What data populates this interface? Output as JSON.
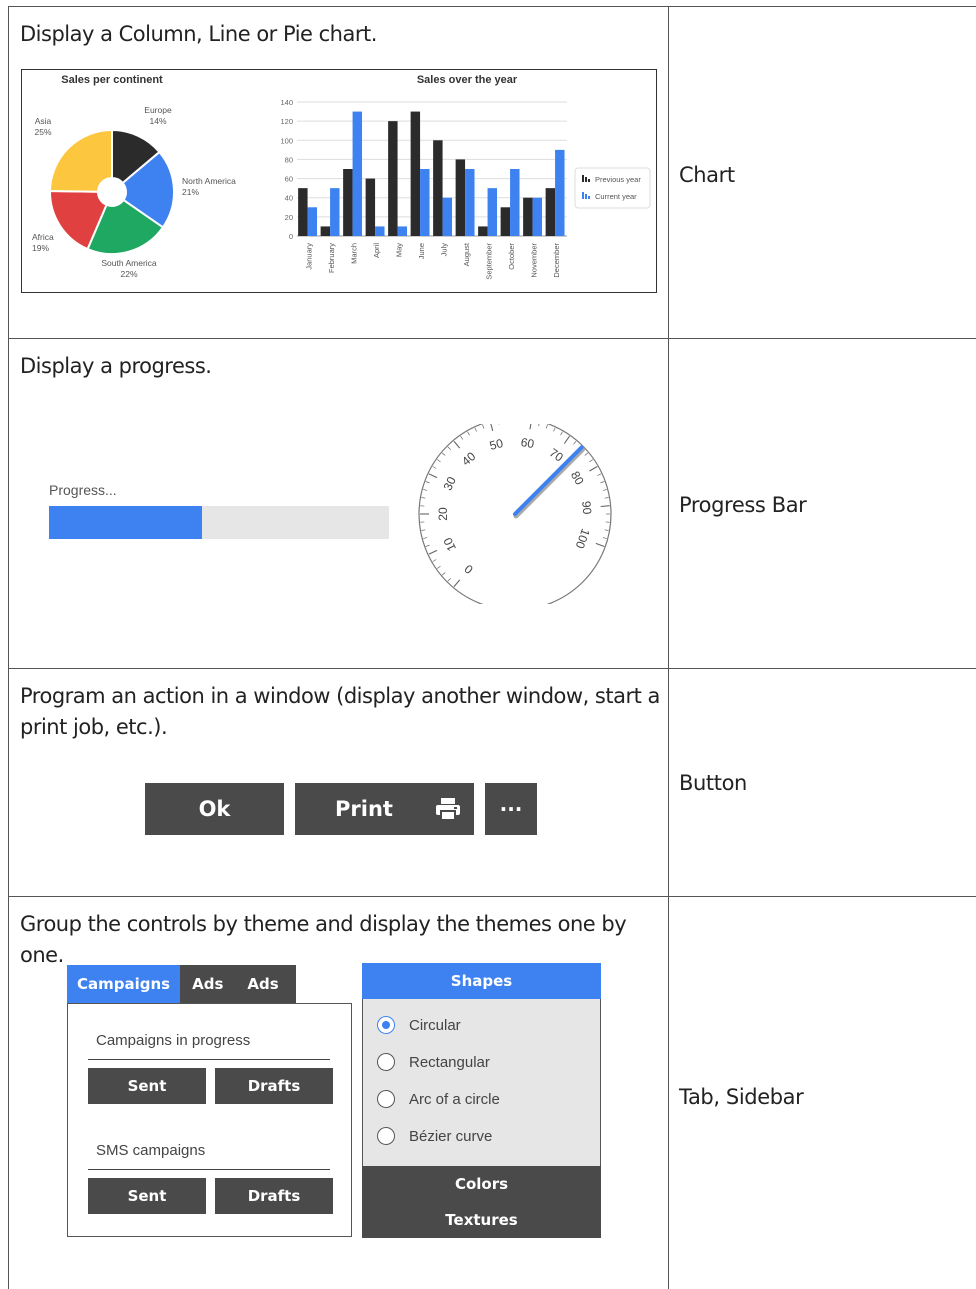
{
  "rows": [
    {
      "description": "Display a Column, Line or Pie chart.",
      "name": "Chart"
    },
    {
      "description": "Display a progress.",
      "name": "Progress Bar"
    },
    {
      "description": "Program an action in a window (display another window, start a print job, etc.).",
      "name": "Button"
    },
    {
      "description": "Group the controls by theme and display the themes one by one.",
      "name": "Tab, Sidebar"
    }
  ],
  "colors": {
    "blue": "#3d82f0",
    "dark": "#4a4a4a",
    "pie_black": "#2b2b2b",
    "pie_blue": "#3d82f0",
    "pie_green": "#1fa862",
    "pie_red": "#e04040",
    "pie_yellow": "#fcc63f"
  },
  "chart_data": [
    {
      "type": "pie",
      "title": "Sales per continent",
      "categories": [
        "Europe",
        "North America",
        "South America",
        "Africa",
        "Asia"
      ],
      "values": [
        14,
        21,
        22,
        19,
        25
      ],
      "value_labels": [
        "14%",
        "21%",
        "22%",
        "19%",
        "25%"
      ],
      "colors": [
        "#2b2b2b",
        "#3d82f0",
        "#1fa862",
        "#e04040",
        "#fcc63f"
      ],
      "donut": true
    },
    {
      "type": "bar",
      "title": "Sales over the year",
      "categories": [
        "January",
        "February",
        "March",
        "April",
        "May",
        "June",
        "July",
        "August",
        "September",
        "October",
        "November",
        "December"
      ],
      "series": [
        {
          "name": "Previous year",
          "color": "#2b2b2b",
          "values": [
            50,
            10,
            70,
            60,
            120,
            130,
            100,
            80,
            10,
            30,
            40,
            50
          ]
        },
        {
          "name": "Current year",
          "color": "#3d82f0",
          "values": [
            30,
            50,
            130,
            10,
            10,
            70,
            40,
            70,
            50,
            70,
            40,
            90
          ]
        }
      ],
      "ylim": [
        0,
        140
      ],
      "yticks": [
        "0",
        "20",
        "40",
        "60",
        "80",
        "100",
        "120",
        "140"
      ],
      "grid": true,
      "legend_position": "right"
    }
  ],
  "progress": {
    "label": "Progress...",
    "fraction": 0.45
  },
  "gauge": {
    "ticks": [
      "0",
      "10",
      "20",
      "30",
      "40",
      "50",
      "60",
      "70",
      "80",
      "90",
      "100"
    ],
    "value": 74
  },
  "buttons": {
    "ok": "Ok",
    "print": "Print",
    "more": "···"
  },
  "tabs": {
    "items": [
      "Campaigns",
      "Ads",
      "Ads"
    ],
    "group1_label": "Campaigns in progress",
    "group2_label": "SMS campaigns",
    "sent": "Sent",
    "drafts": "Drafts"
  },
  "sidebar": {
    "header": "Shapes",
    "options": [
      "Circular",
      "Rectangular",
      "Arc of a circle",
      "Bézier curve"
    ],
    "selected_index": 0,
    "footer_items": [
      "Colors",
      "Textures"
    ]
  }
}
